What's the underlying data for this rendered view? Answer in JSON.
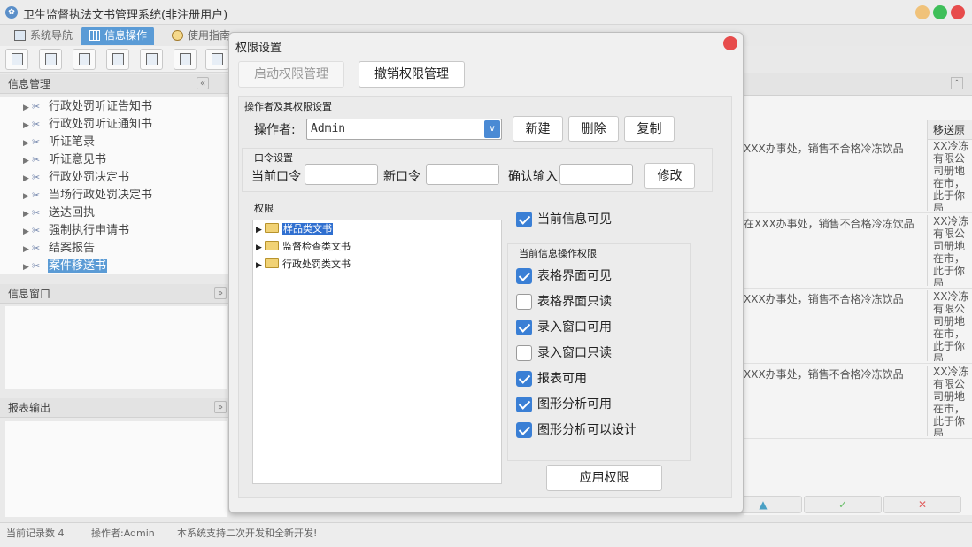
{
  "app": {
    "title": "卫生监督执法文书管理系统(非注册用户)",
    "tabs": [
      "系统导航",
      "信息操作",
      "使用指南"
    ],
    "active_tab": 1
  },
  "sidebar": {
    "header": "信息管理",
    "items": [
      {
        "label": "行政处罚听证告知书"
      },
      {
        "label": "行政处罚听证通知书"
      },
      {
        "label": "听证笔录"
      },
      {
        "label": "听证意见书"
      },
      {
        "label": "行政处罚决定书"
      },
      {
        "label": "当场行政处罚决定书"
      },
      {
        "label": "送达回执"
      },
      {
        "label": "强制执行申请书"
      },
      {
        "label": "结案报告"
      },
      {
        "label": "案件移送书"
      }
    ],
    "selected": 9,
    "info_window": "信息窗口",
    "report_output": "报表输出"
  },
  "table": {
    "column_header": "移送原",
    "rows": [
      {
        "text": "XXX办事处，销售不合格冷冻饮品",
        "col": "XX冷冻有限公司册地在市，此于你局"
      },
      {
        "text": "在XXX办事处，销售不合格冷冻饮品",
        "col": "XX冷冻有限公司册地在市，此于你局"
      },
      {
        "text": "XXX办事处，销售不合格冷冻饮品",
        "col": "XX冷冻有限公司册地在市，此于你局"
      },
      {
        "text": "XXX办事处，销售不合格冷冻饮品",
        "col": "XX冷冻有限公司册地在市，此于你局"
      }
    ]
  },
  "status": {
    "record_count": "当前记录数 4",
    "operator": "操作者:Admin",
    "message": "本系统支持二次开发和全新开发!"
  },
  "dialog": {
    "title": "权限设置",
    "enable_button": "启动权限管理",
    "disable_button": "撤销权限管理",
    "operator_group": "操作者及其权限设置",
    "operator_label": "操作者:",
    "operator_value": "Admin",
    "new_button": "新建",
    "delete_button": "删除",
    "copy_button": "复制",
    "password_group": "口令设置",
    "current_pwd": "当前口令",
    "new_pwd": "新口令",
    "confirm_pwd": "确认输入",
    "modify_button": "修改",
    "permission_group": "权限",
    "tree": [
      {
        "label": "样品类文书",
        "selected": true
      },
      {
        "label": "监督检查类文书",
        "selected": false
      },
      {
        "label": "行政处罚类文书",
        "selected": false
      }
    ],
    "current_visible": {
      "label": "当前信息可见",
      "checked": true
    },
    "ops_group": "当前信息操作权限",
    "ops": [
      {
        "label": "表格界面可见",
        "checked": true
      },
      {
        "label": "表格界面只读",
        "checked": false
      },
      {
        "label": "录入窗口可用",
        "checked": true
      },
      {
        "label": "录入窗口只读",
        "checked": false
      },
      {
        "label": "报表可用",
        "checked": true
      },
      {
        "label": "图形分析可用",
        "checked": true
      },
      {
        "label": "图形分析可以设计",
        "checked": true
      }
    ],
    "apply_button": "应用权限"
  },
  "colors": {
    "accent": "#5a9bd6",
    "close": "#e74c4c",
    "check": "#3a7fd5"
  }
}
